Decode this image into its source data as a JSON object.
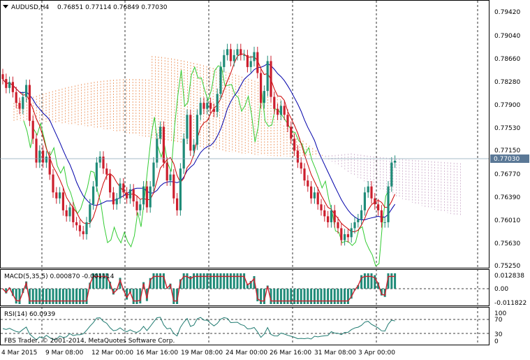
{
  "header": {
    "symbol_label": "AUDUSD,H4",
    "ohlc": "0.76851 0.77114 0.76849 0.77030"
  },
  "main_axis": {
    "ticks": [
      "0.79420",
      "0.79040",
      "0.78660",
      "0.78280",
      "0.77900",
      "0.77530",
      "0.77150",
      "0.76770",
      "0.76390",
      "0.76010",
      "0.75630",
      "0.75250"
    ],
    "current_price": "0.77030"
  },
  "macd": {
    "label": "MACD(5,35,5) 0.000870 -0.001114",
    "ticks": [
      "0.012838",
      "0.00",
      "-0.011822"
    ]
  },
  "rsi": {
    "label": "RSI(14) 60.0939",
    "ticks": [
      "100",
      "70",
      "30",
      "0"
    ]
  },
  "copyright": "FBS Trader, © 2001-2014, MetaQuotes Software Corp.",
  "time_axis": [
    "4 Mar 2015",
    "9 Mar 08:00",
    "12 Mar 00:00",
    "16 Mar 16:00",
    "19 Mar 08:00",
    "24 Mar 00:00",
    "26 Mar 16:00",
    "31 Mar 08:00",
    "3 Apr 00:00"
  ],
  "colors": {
    "bull": "#1f8b78",
    "bear": "#cc1f2d",
    "tenkan": "#cc0000",
    "kijun": "#0000aa",
    "chikou": "#33cc33",
    "kumo_a": "#e9884c",
    "kumo_b": "#c8a6c6",
    "macd_line": "#cc1f2d",
    "macd_hist": "#1f8b78",
    "rsi_line": "#1f7a70",
    "price_line": "#8aa6b8"
  },
  "chart_data": {
    "type": "candlestick",
    "symbol": "AUDUSD",
    "timeframe": "H4",
    "ohlc_last": {
      "open": 0.76851,
      "high": 0.77114,
      "low": 0.76849,
      "close": 0.7703
    },
    "ylim": [
      0.7525,
      0.797
    ],
    "candles_close": [
      0.784,
      0.7825,
      0.7835,
      0.7818,
      0.78,
      0.779,
      0.781,
      0.783,
      0.777,
      0.774,
      0.77,
      0.772,
      0.77,
      0.771,
      0.768,
      0.765,
      0.764,
      0.765,
      0.762,
      0.761,
      0.7625,
      0.76,
      0.7595,
      0.7585,
      0.758,
      0.76,
      0.763,
      0.766,
      0.77,
      0.771,
      0.769,
      0.768,
      0.765,
      0.763,
      0.764,
      0.7665,
      0.765,
      0.764,
      0.7655,
      0.7635,
      0.762,
      0.763,
      0.766,
      0.7625,
      0.766,
      0.77,
      0.774,
      0.776,
      0.77,
      0.767,
      0.768,
      0.764,
      0.762,
      0.769,
      0.774,
      0.778,
      0.772,
      0.773,
      0.778,
      0.78,
      0.779,
      0.78,
      0.779,
      0.7785,
      0.7815,
      0.786,
      0.788,
      0.789,
      0.787,
      0.788,
      0.789,
      0.788,
      0.788,
      0.786,
      0.787,
      0.7885,
      0.785,
      0.78,
      0.782,
      0.787,
      0.781,
      0.779,
      0.778,
      0.7795,
      0.778,
      0.776,
      0.774,
      0.772,
      0.77,
      0.769,
      0.767,
      0.766,
      0.764,
      0.765,
      0.763,
      0.762,
      0.761,
      0.76,
      0.762,
      0.76,
      0.759,
      0.757,
      0.758,
      0.7575,
      0.759,
      0.76,
      0.7605,
      0.762,
      0.765,
      0.766,
      0.764,
      0.763,
      0.762,
      0.76,
      0.76,
      0.766,
      0.77,
      0.7703
    ],
    "rsi_last": 60.0939,
    "macd_last": [
      0.00087,
      -0.001114
    ]
  }
}
